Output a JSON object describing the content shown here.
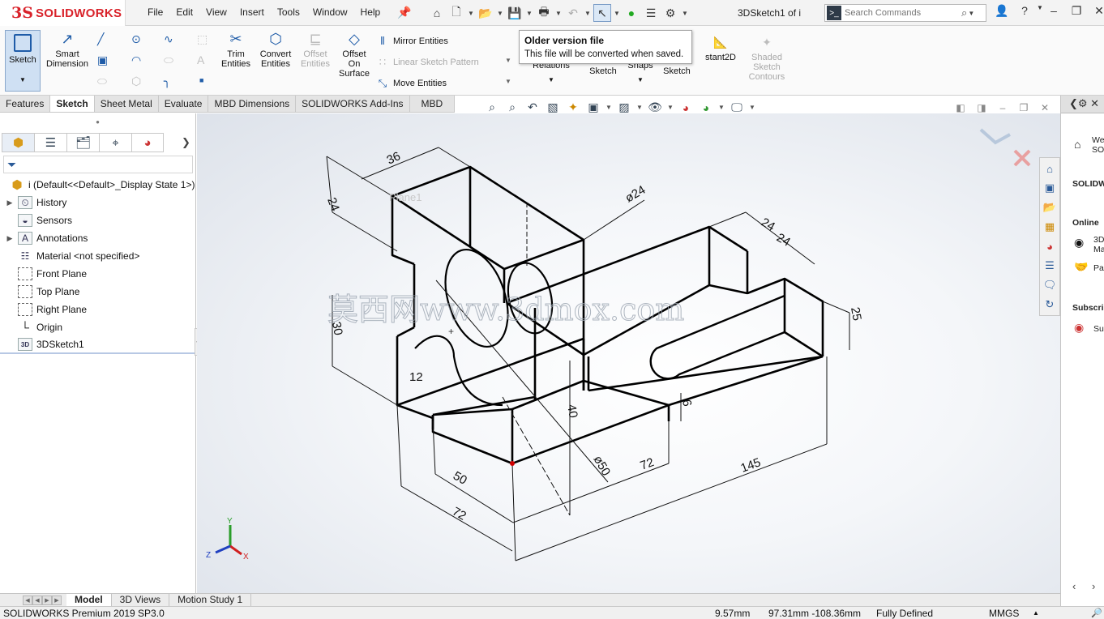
{
  "app": {
    "logo_ds": "3S",
    "logo_name": "SOLIDWORKS",
    "doc_title": "3DSketch1 of i"
  },
  "menu": [
    "File",
    "Edit",
    "View",
    "Insert",
    "Tools",
    "Window",
    "Help"
  ],
  "search": {
    "placeholder": "Search Commands"
  },
  "ribbon": {
    "sketch": "Sketch",
    "smart_dimension": "Smart Dimension",
    "trim_entities": "Trim Entities",
    "convert_entities": "Convert Entities",
    "offset_entities": "Offset Entities",
    "offset_on_surface": "Offset On Surface",
    "mirror_entities": "Mirror Entities",
    "linear_sketch_pattern": "Linear Sketch Pattern",
    "move_entities": "Move Entities",
    "relations": "Relations",
    "sketch_short": "Sketch",
    "snaps": "Snaps",
    "sketch2": "Sketch",
    "instant2d": "stant2D",
    "shaded_sketch_contours": "Shaded Sketch Contours"
  },
  "tooltip": {
    "title": "Older version file",
    "body": "This file will be converted when saved."
  },
  "cm_tabs": [
    "Features",
    "Sketch",
    "Sheet Metal",
    "Evaluate",
    "MBD Dimensions",
    "SOLIDWORKS Add-Ins",
    "MBD"
  ],
  "cm_active": "Sketch",
  "tree": {
    "root": "i  (Default<<Default>_Display State 1>)",
    "items": [
      {
        "label": "History",
        "icon": "history-icon",
        "expandable": true
      },
      {
        "label": "Sensors",
        "icon": "sensors-icon",
        "expandable": false
      },
      {
        "label": "Annotations",
        "icon": "annotations-icon",
        "expandable": true
      },
      {
        "label": "Material <not specified>",
        "icon": "material-icon",
        "expandable": false
      },
      {
        "label": "Front Plane",
        "icon": "plane-icon",
        "expandable": false
      },
      {
        "label": "Top Plane",
        "icon": "plane-icon",
        "expandable": false
      },
      {
        "label": "Right Plane",
        "icon": "plane-icon",
        "expandable": false
      },
      {
        "label": "Origin",
        "icon": "origin-icon",
        "expandable": false
      },
      {
        "label": "3DSketch1",
        "icon": "3d-sketch-icon",
        "expandable": false
      }
    ]
  },
  "drawing": {
    "dims": [
      "36",
      "24",
      "ø24",
      "24",
      "24",
      "25",
      "30",
      "12",
      "6",
      "40",
      "ø50",
      "72",
      "145",
      "50",
      "72"
    ],
    "plane_label": "Plane1",
    "watermark": "莫西网www.3dmox.com",
    "triad": [
      "Y",
      "Z",
      "X"
    ]
  },
  "taskpane": {
    "items": [
      "We",
      "SO",
      "SOLIDW",
      "Online",
      "3D",
      "Ma",
      "Pa",
      "Subscri",
      "Su"
    ]
  },
  "bottom_tabs": [
    "Model",
    "3D Views",
    "Motion Study 1"
  ],
  "bottom_active": "Model",
  "status": {
    "product": "SOLIDWORKS Premium 2019 SP3.0",
    "length": "9.57mm",
    "coords": "97.31mm -108.36mm",
    "state": "Fully Defined",
    "units": "MMGS"
  },
  "colors": {
    "brand": "#d9222a",
    "accent": "#1f5ca8",
    "origin_point": "#d00000"
  }
}
